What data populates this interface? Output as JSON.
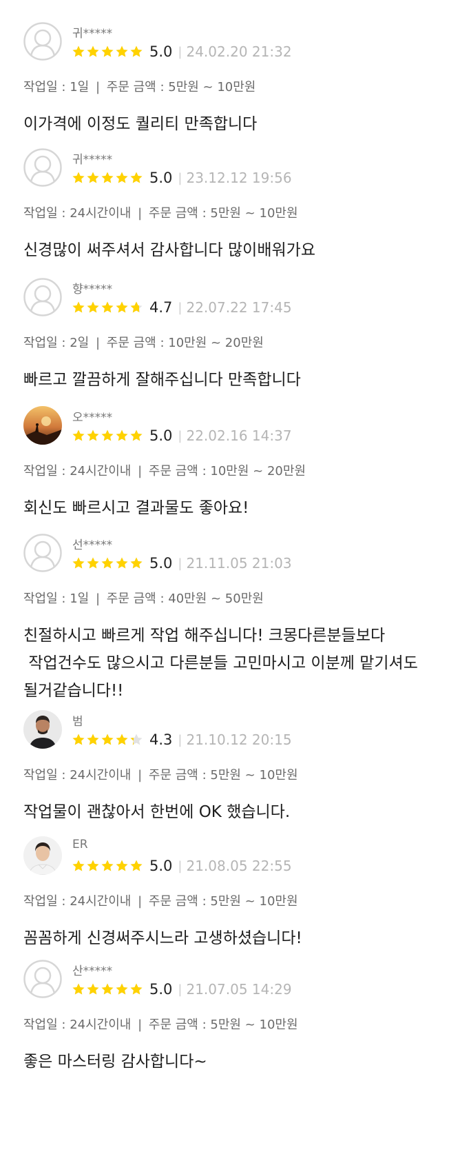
{
  "labels": {
    "work_period": "작업일 :",
    "order_amount": "주문 금액 :"
  },
  "colors": {
    "star": "#FFD200",
    "star_empty": "#E2E2E2",
    "date": "#B5B5B5"
  },
  "reviews": [
    {
      "name": "귀*****",
      "avatar": "default-avatar-icon",
      "score": "5.0",
      "stars": 5.0,
      "date": "24.02.20 21:32",
      "work_period": "1일",
      "amount": "5만원 ~ 10만원",
      "text": "이가격에 이정도 퀄리티 만족합니다"
    },
    {
      "name": "귀*****",
      "avatar": "default-avatar-icon",
      "score": "5.0",
      "stars": 5.0,
      "date": "23.12.12 19:56",
      "work_period": "24시간이내",
      "amount": "5만원 ~ 10만원",
      "text": "신경많이 써주셔서 감사합니다 많이배워가요"
    },
    {
      "name": "향*****",
      "avatar": "default-avatar-icon",
      "score": "4.7",
      "stars": 4.7,
      "date": "22.07.22 17:45",
      "work_period": "2일",
      "amount": "10만원 ~ 20만원",
      "text": "빠르고 깔끔하게 잘해주십니다 만족합니다"
    },
    {
      "name": "오*****",
      "avatar": "sunset-photo-avatar",
      "score": "5.0",
      "stars": 5.0,
      "date": "22.02.16 14:37",
      "work_period": "24시간이내",
      "amount": "10만원 ~ 20만원",
      "text": "회신도 빠르시고 결과물도 좋아요!"
    },
    {
      "name": "선*****",
      "avatar": "default-avatar-icon",
      "score": "5.0",
      "stars": 5.0,
      "date": "21.11.05 21:03",
      "work_period": "1일",
      "amount": "40만원 ~ 50만원",
      "text": "친절하시고 빠르게 작업 해주십니다! 크몽다른분들보다\n 작업건수도 많으시고 다른분들 고민마시고 이분께 맡기셔도 될거같습니다!!"
    },
    {
      "name": "범",
      "avatar": "man-photo-avatar",
      "score": "4.3",
      "stars": 4.3,
      "date": "21.10.12 20:15",
      "work_period": "24시간이내",
      "amount": "5만원 ~ 10만원",
      "text": "작업물이 괜찮아서 한번에 OK 했습니다."
    },
    {
      "name": "ER",
      "avatar": "young-man-photo-avatar",
      "score": "5.0",
      "stars": 5.0,
      "date": "21.08.05 22:55",
      "work_period": "24시간이내",
      "amount": "5만원 ~ 10만원",
      "text": "꼼꼼하게 신경써주시느라 고생하셨습니다!"
    },
    {
      "name": "산*****",
      "avatar": "default-avatar-icon",
      "score": "5.0",
      "stars": 5.0,
      "date": "21.07.05 14:29",
      "work_period": "24시간이내",
      "amount": "5만원 ~ 10만원",
      "text": "좋은 마스터링 감사합니다~"
    }
  ]
}
